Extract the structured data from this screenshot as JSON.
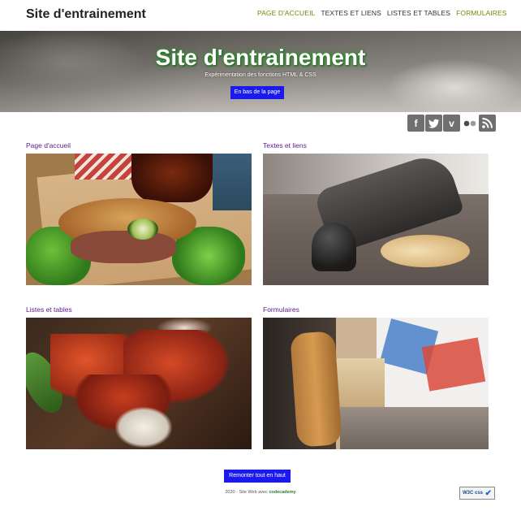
{
  "header": {
    "brand": "Site d'entrainement",
    "nav": [
      {
        "label": "PAGE D'ACCUEIL"
      },
      {
        "label": "TEXTES ET LIENS"
      },
      {
        "label": "LISTES ET TABLES"
      },
      {
        "label": "FORMULAIRES"
      }
    ]
  },
  "hero": {
    "title": "Site d'entrainement",
    "subtitle": "Expérimentation des fonctions HTML & CSS",
    "button": "En bas de la page"
  },
  "social": [
    "facebook-icon",
    "twitter-icon",
    "vimeo-icon",
    "flickr-icon",
    "rss-icon"
  ],
  "cards": [
    {
      "label": "Page d'accueil"
    },
    {
      "label": "Textes et liens"
    },
    {
      "label": "Listes et tables"
    },
    {
      "label": "Formulaires"
    }
  ],
  "footer": {
    "back_to_top": "Remonter tout en haut",
    "credit_prefix": "2020 - Site Web avec",
    "credit_brand": "codecademy",
    "w3c_label": "W3C css"
  },
  "colors": {
    "accent_nav": "#6b8e00",
    "button_blue": "#1a1aee",
    "link_purple": "#5a1a8a"
  }
}
